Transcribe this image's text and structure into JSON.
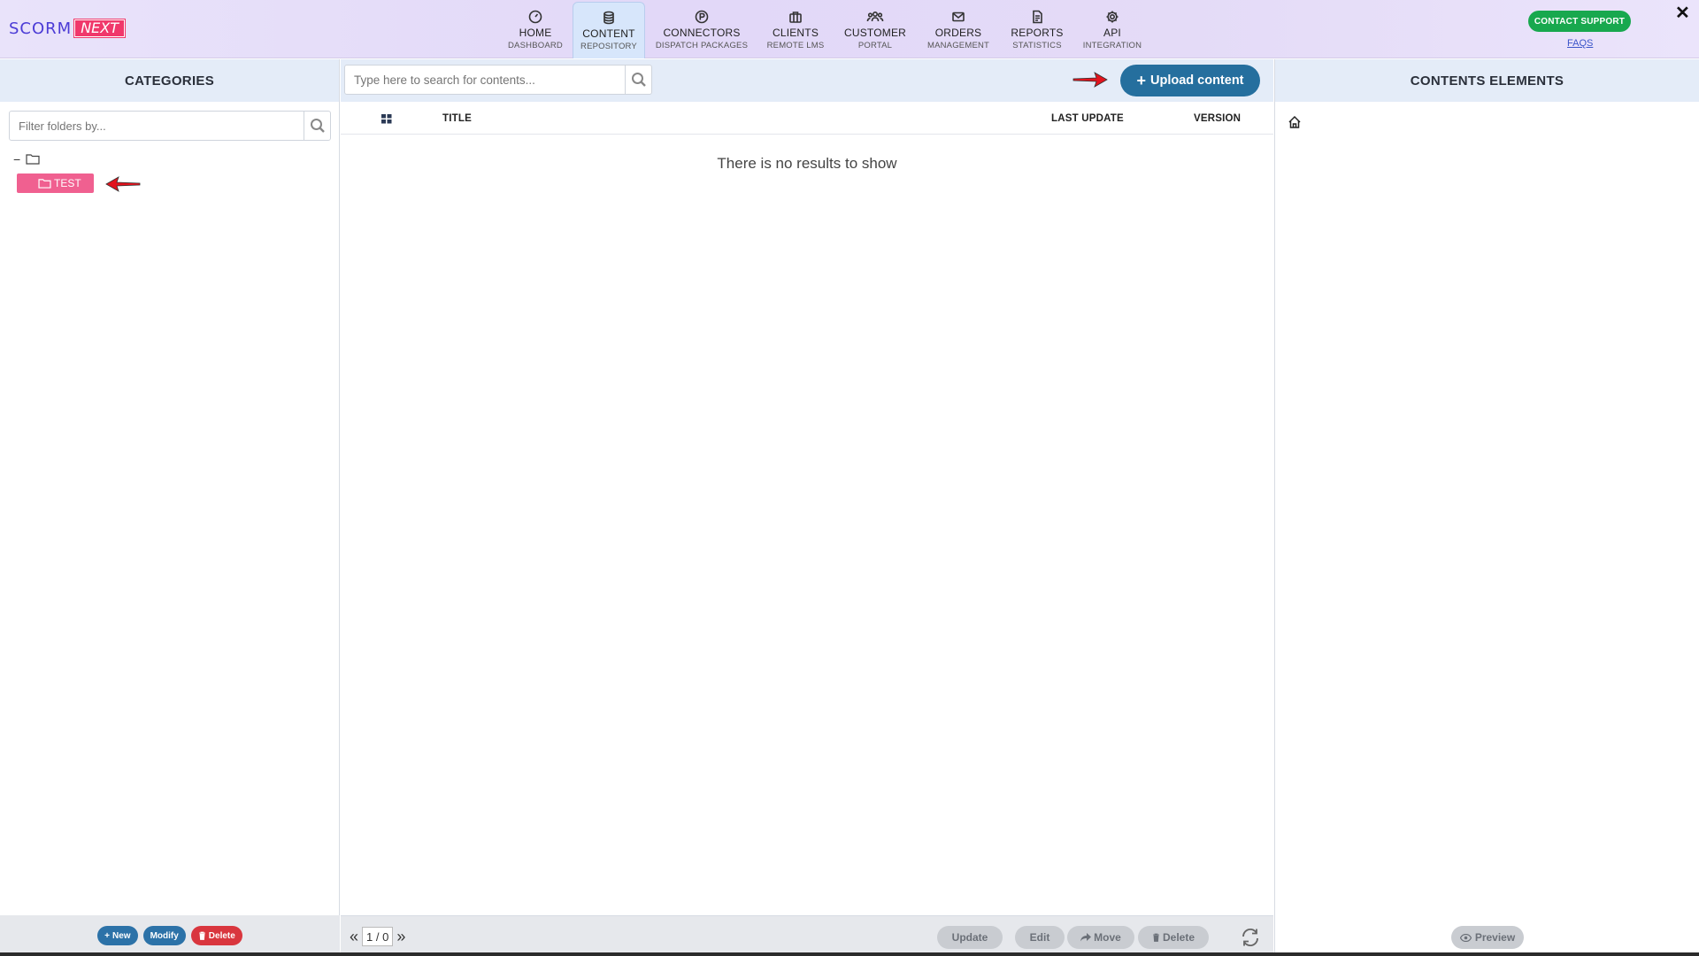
{
  "brand": {
    "part1": "SCORM",
    "part2": "NEXT"
  },
  "nav": [
    {
      "label": "HOME",
      "sub": "DASHBOARD",
      "icon": "gauge-icon"
    },
    {
      "label": "CONTENT",
      "sub": "REPOSITORY",
      "icon": "database-icon",
      "active": true
    },
    {
      "label": "CONNECTORS",
      "sub": "DISPATCH PACKAGES",
      "icon": "p-circle-icon"
    },
    {
      "label": "CLIENTS",
      "sub": "REMOTE LMS",
      "icon": "briefcase-icon"
    },
    {
      "label": "CUSTOMER",
      "sub": "PORTAL",
      "icon": "users-icon"
    },
    {
      "label": "ORDERS",
      "sub": "MANAGEMENT",
      "icon": "envelope-icon"
    },
    {
      "label": "REPORTS",
      "sub": "STATISTICS",
      "icon": "document-icon"
    },
    {
      "label": "API",
      "sub": "INTEGRATION",
      "icon": "gear-icon"
    }
  ],
  "header": {
    "contact_label": "CONTACT SUPPORT",
    "faqs_label": "FAQS",
    "close_label": "✕"
  },
  "categories": {
    "title": "CATEGORIES",
    "filter_placeholder": "Filter folders by...",
    "tree_root_toggle": "−",
    "folder_name": "TEST",
    "buttons": {
      "new": "New",
      "modify": "Modify",
      "delete": "Delete"
    }
  },
  "contents": {
    "search_placeholder": "Type here to search for contents...",
    "upload_label": "Upload content",
    "columns": {
      "title": "TITLE",
      "last_update": "LAST UPDATE",
      "version": "VERSION"
    },
    "empty_message": "There is no results to show",
    "pager": {
      "current": "1 / 0"
    },
    "actions": {
      "update": "Update",
      "edit": "Edit",
      "move": "Move",
      "delete": "Delete"
    }
  },
  "elements": {
    "title": "CONTENTS ELEMENTS",
    "preview_label": "Preview"
  },
  "colors": {
    "accent": "#256f9e",
    "folder": "#f06090",
    "contact": "#18a84e",
    "danger": "#d9363e"
  }
}
